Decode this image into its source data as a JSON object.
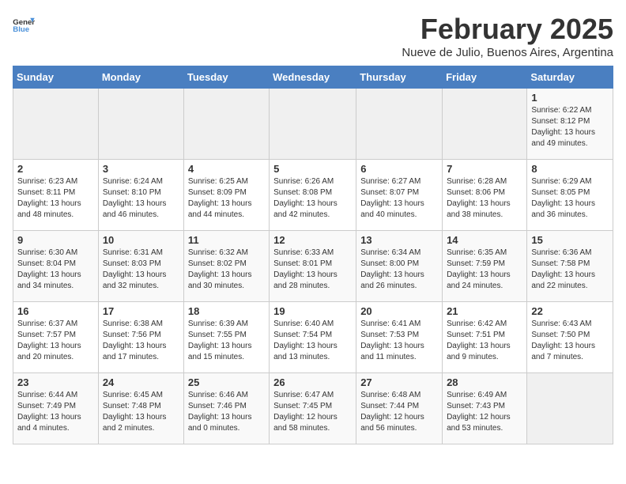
{
  "header": {
    "logo_general": "General",
    "logo_blue": "Blue",
    "month_title": "February 2025",
    "subtitle": "Nueve de Julio, Buenos Aires, Argentina"
  },
  "weekdays": [
    "Sunday",
    "Monday",
    "Tuesday",
    "Wednesday",
    "Thursday",
    "Friday",
    "Saturday"
  ],
  "weeks": [
    [
      {
        "day": "",
        "info": ""
      },
      {
        "day": "",
        "info": ""
      },
      {
        "day": "",
        "info": ""
      },
      {
        "day": "",
        "info": ""
      },
      {
        "day": "",
        "info": ""
      },
      {
        "day": "",
        "info": ""
      },
      {
        "day": "1",
        "info": "Sunrise: 6:22 AM\nSunset: 8:12 PM\nDaylight: 13 hours\nand 49 minutes."
      }
    ],
    [
      {
        "day": "2",
        "info": "Sunrise: 6:23 AM\nSunset: 8:11 PM\nDaylight: 13 hours\nand 48 minutes."
      },
      {
        "day": "3",
        "info": "Sunrise: 6:24 AM\nSunset: 8:10 PM\nDaylight: 13 hours\nand 46 minutes."
      },
      {
        "day": "4",
        "info": "Sunrise: 6:25 AM\nSunset: 8:09 PM\nDaylight: 13 hours\nand 44 minutes."
      },
      {
        "day": "5",
        "info": "Sunrise: 6:26 AM\nSunset: 8:08 PM\nDaylight: 13 hours\nand 42 minutes."
      },
      {
        "day": "6",
        "info": "Sunrise: 6:27 AM\nSunset: 8:07 PM\nDaylight: 13 hours\nand 40 minutes."
      },
      {
        "day": "7",
        "info": "Sunrise: 6:28 AM\nSunset: 8:06 PM\nDaylight: 13 hours\nand 38 minutes."
      },
      {
        "day": "8",
        "info": "Sunrise: 6:29 AM\nSunset: 8:05 PM\nDaylight: 13 hours\nand 36 minutes."
      }
    ],
    [
      {
        "day": "9",
        "info": "Sunrise: 6:30 AM\nSunset: 8:04 PM\nDaylight: 13 hours\nand 34 minutes."
      },
      {
        "day": "10",
        "info": "Sunrise: 6:31 AM\nSunset: 8:03 PM\nDaylight: 13 hours\nand 32 minutes."
      },
      {
        "day": "11",
        "info": "Sunrise: 6:32 AM\nSunset: 8:02 PM\nDaylight: 13 hours\nand 30 minutes."
      },
      {
        "day": "12",
        "info": "Sunrise: 6:33 AM\nSunset: 8:01 PM\nDaylight: 13 hours\nand 28 minutes."
      },
      {
        "day": "13",
        "info": "Sunrise: 6:34 AM\nSunset: 8:00 PM\nDaylight: 13 hours\nand 26 minutes."
      },
      {
        "day": "14",
        "info": "Sunrise: 6:35 AM\nSunset: 7:59 PM\nDaylight: 13 hours\nand 24 minutes."
      },
      {
        "day": "15",
        "info": "Sunrise: 6:36 AM\nSunset: 7:58 PM\nDaylight: 13 hours\nand 22 minutes."
      }
    ],
    [
      {
        "day": "16",
        "info": "Sunrise: 6:37 AM\nSunset: 7:57 PM\nDaylight: 13 hours\nand 20 minutes."
      },
      {
        "day": "17",
        "info": "Sunrise: 6:38 AM\nSunset: 7:56 PM\nDaylight: 13 hours\nand 17 minutes."
      },
      {
        "day": "18",
        "info": "Sunrise: 6:39 AM\nSunset: 7:55 PM\nDaylight: 13 hours\nand 15 minutes."
      },
      {
        "day": "19",
        "info": "Sunrise: 6:40 AM\nSunset: 7:54 PM\nDaylight: 13 hours\nand 13 minutes."
      },
      {
        "day": "20",
        "info": "Sunrise: 6:41 AM\nSunset: 7:53 PM\nDaylight: 13 hours\nand 11 minutes."
      },
      {
        "day": "21",
        "info": "Sunrise: 6:42 AM\nSunset: 7:51 PM\nDaylight: 13 hours\nand 9 minutes."
      },
      {
        "day": "22",
        "info": "Sunrise: 6:43 AM\nSunset: 7:50 PM\nDaylight: 13 hours\nand 7 minutes."
      }
    ],
    [
      {
        "day": "23",
        "info": "Sunrise: 6:44 AM\nSunset: 7:49 PM\nDaylight: 13 hours\nand 4 minutes."
      },
      {
        "day": "24",
        "info": "Sunrise: 6:45 AM\nSunset: 7:48 PM\nDaylight: 13 hours\nand 2 minutes."
      },
      {
        "day": "25",
        "info": "Sunrise: 6:46 AM\nSunset: 7:46 PM\nDaylight: 13 hours\nand 0 minutes."
      },
      {
        "day": "26",
        "info": "Sunrise: 6:47 AM\nSunset: 7:45 PM\nDaylight: 12 hours\nand 58 minutes."
      },
      {
        "day": "27",
        "info": "Sunrise: 6:48 AM\nSunset: 7:44 PM\nDaylight: 12 hours\nand 56 minutes."
      },
      {
        "day": "28",
        "info": "Sunrise: 6:49 AM\nSunset: 7:43 PM\nDaylight: 12 hours\nand 53 minutes."
      },
      {
        "day": "",
        "info": ""
      }
    ]
  ]
}
